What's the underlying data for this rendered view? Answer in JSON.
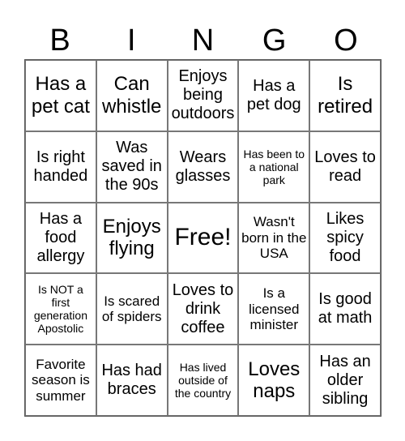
{
  "header": [
    "B",
    "I",
    "N",
    "G",
    "O"
  ],
  "cells": [
    "Has a pet cat",
    "Can whistle",
    "Enjoys being outdoors",
    "Has a pet dog",
    "Is retired",
    "Is right handed",
    "Was saved in the 90s",
    "Wears glasses",
    "Has been to a national park",
    "Loves to read",
    "Has a food allergy",
    "Enjoys flying",
    "Free!",
    "Wasn't born in the USA",
    "Likes spicy food",
    "Is NOT a first generation Apostolic",
    "Is scared of spiders",
    "Loves to drink coffee",
    "Is a licensed minister",
    "Is good at math",
    "Favorite season is summer",
    "Has had braces",
    "Has lived outside of the country",
    "Loves naps",
    "Has an older sibling"
  ]
}
